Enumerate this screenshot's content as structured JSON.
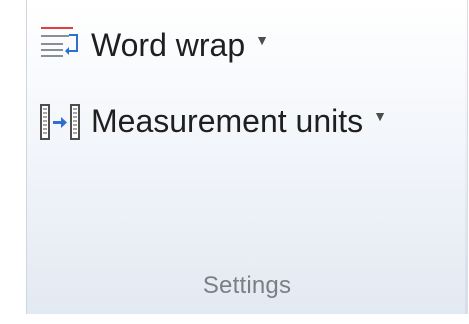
{
  "ribbon_group": {
    "label": "Settings",
    "commands": [
      {
        "label": "Word wrap",
        "icon": "word-wrap-icon",
        "has_dropdown": true
      },
      {
        "label": "Measurement units",
        "icon": "measurement-units-icon",
        "has_dropdown": true
      }
    ]
  },
  "colors": {
    "text": "#1f1f1f",
    "group_label": "#7b7f85",
    "icon_blue": "#2f6fd1",
    "icon_red": "#e0413a"
  }
}
